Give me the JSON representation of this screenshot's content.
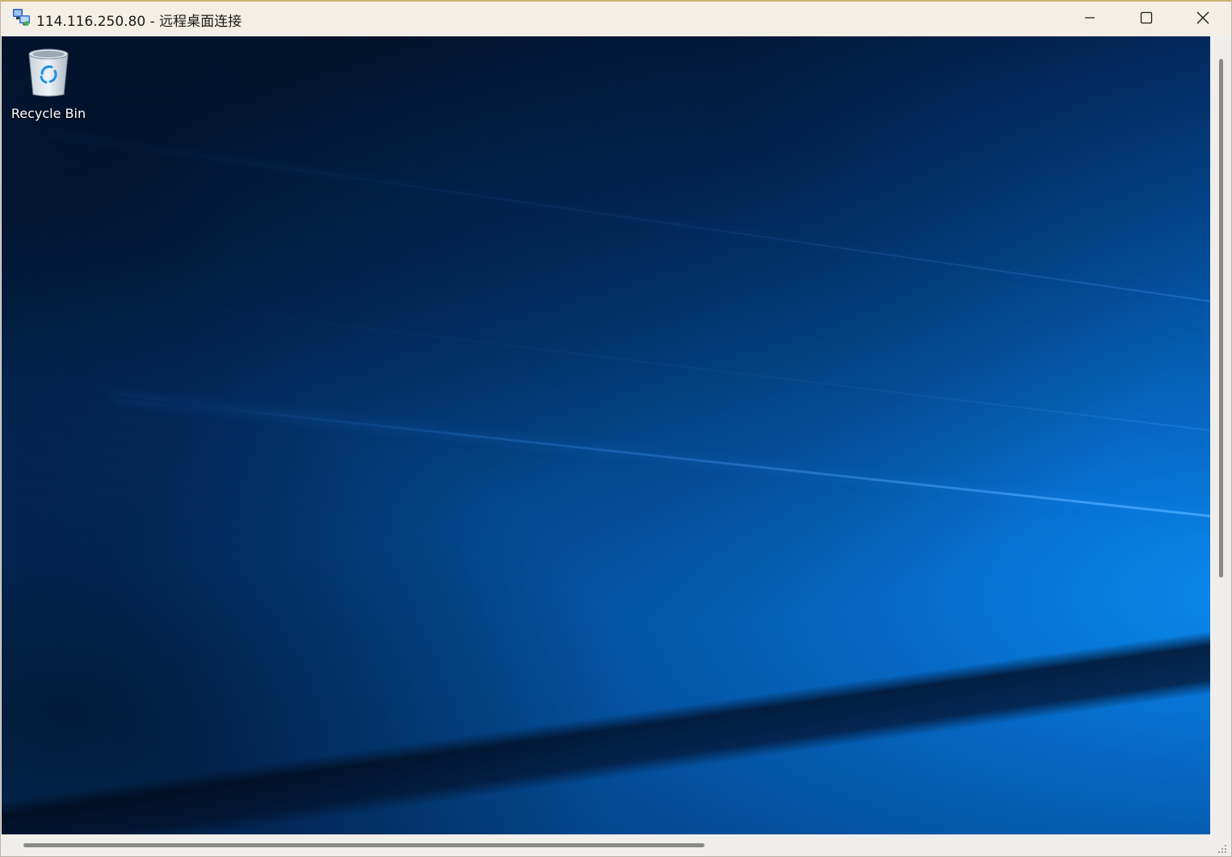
{
  "window": {
    "title": "114.116.250.80 - 远程桌面连接",
    "app_icon": "remote-desktop-icon",
    "controls": {
      "minimize_icon": "minimize-icon",
      "maximize_icon": "maximize-icon",
      "close_icon": "close-icon"
    }
  },
  "desktop": {
    "icons": [
      {
        "label": "Recycle Bin",
        "icon": "recycle-bin-icon"
      }
    ]
  },
  "colors": {
    "titlebar": "#f4efe6",
    "wallpaper_dark": "#021733",
    "wallpaper_light": "#0a8bf0",
    "scrollbar_thumb": "#8a8a8a"
  }
}
